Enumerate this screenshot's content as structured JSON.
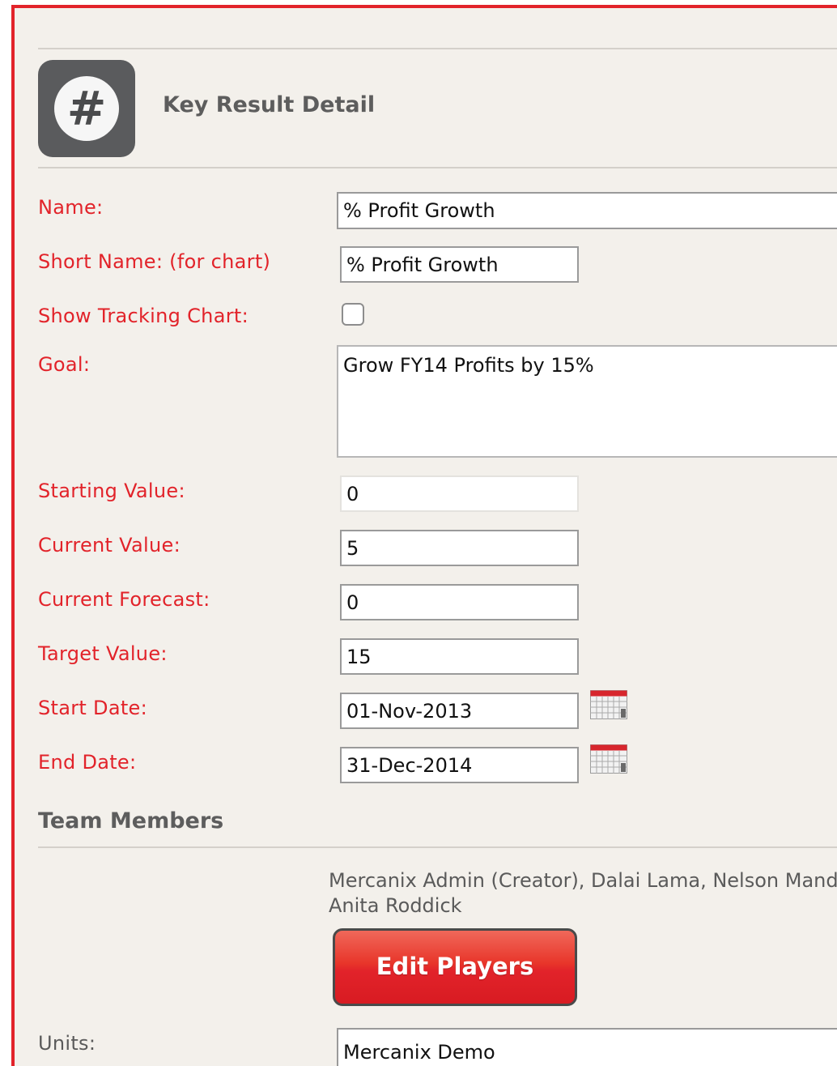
{
  "header": {
    "title": "Key Result Detail",
    "logo_glyph": "#",
    "logo_icon": "hashtag-icon"
  },
  "form": {
    "name": {
      "label": "Name:",
      "value": "% Profit Growth"
    },
    "short_name": {
      "label": "Short Name: (for chart)",
      "value": "% Profit Growth"
    },
    "show_tracking_chart": {
      "label": "Show Tracking Chart:",
      "checked": false
    },
    "goal": {
      "label": "Goal:",
      "value": "Grow FY14 Profits by 15%"
    },
    "starting_value": {
      "label": "Starting Value:",
      "value": "0"
    },
    "current_value": {
      "label": "Current Value:",
      "value": "5"
    },
    "current_forecast": {
      "label": "Current Forecast:",
      "value": "0"
    },
    "target_value": {
      "label": "Target Value:",
      "value": "15"
    },
    "start_date": {
      "label": "Start Date:",
      "value": "01-Nov-2013"
    },
    "end_date": {
      "label": "End Date:",
      "value": "31-Dec-2014"
    }
  },
  "team": {
    "title": "Team Members",
    "members_line1": "Mercanix Admin (Creator), Dalai Lama, Nelson Mandela,",
    "members_line2": "Anita Roddick",
    "edit_button": "Edit Players"
  },
  "units": {
    "label": "Units:",
    "value": "Mercanix Demo"
  },
  "colors": {
    "accent": "#e2232a",
    "background": "#f3f0eb",
    "heading": "#5d5d5d"
  }
}
